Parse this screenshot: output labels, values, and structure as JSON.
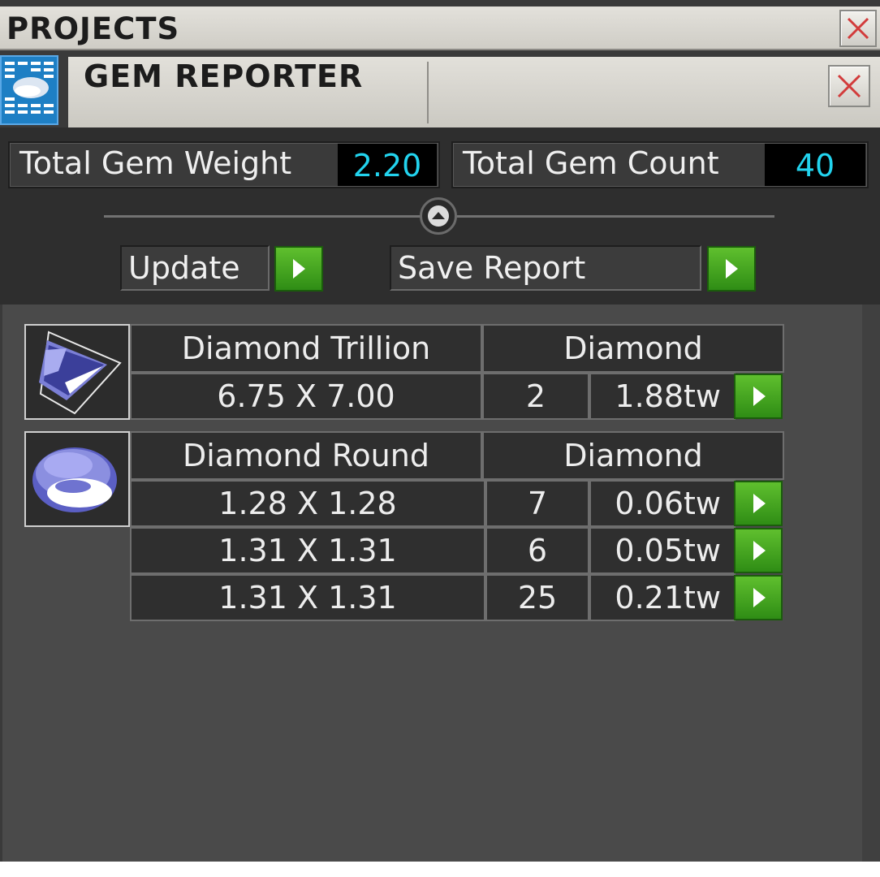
{
  "projects": {
    "title": "PROJECTS"
  },
  "gem_reporter": {
    "title": "GEM REPORTER"
  },
  "stats": {
    "weight_label": "Total Gem Weight",
    "weight_value": "2.20",
    "count_label": "Total Gem Count",
    "count_value": "40"
  },
  "actions": {
    "update_label": "Update",
    "save_label": "Save Report"
  },
  "groups": [
    {
      "name": "Diamond Trillion",
      "material": "Diamond",
      "shape": "trillion",
      "rows": [
        {
          "size": "6.75 X 7.00",
          "count": "2",
          "weight": "1.88tw"
        }
      ]
    },
    {
      "name": "Diamond Round",
      "material": "Diamond",
      "shape": "round",
      "rows": [
        {
          "size": "1.28 X 1.28",
          "count": "7",
          "weight": "0.06tw"
        },
        {
          "size": "1.31 X 1.31",
          "count": "6",
          "weight": "0.05tw"
        },
        {
          "size": "1.31 X 1.31",
          "count": "25",
          "weight": "0.21tw"
        }
      ]
    }
  ],
  "colors": {
    "accent_value": "#22d3ee",
    "go_button": "#3fa51f",
    "close_x": "#d23b3b"
  }
}
